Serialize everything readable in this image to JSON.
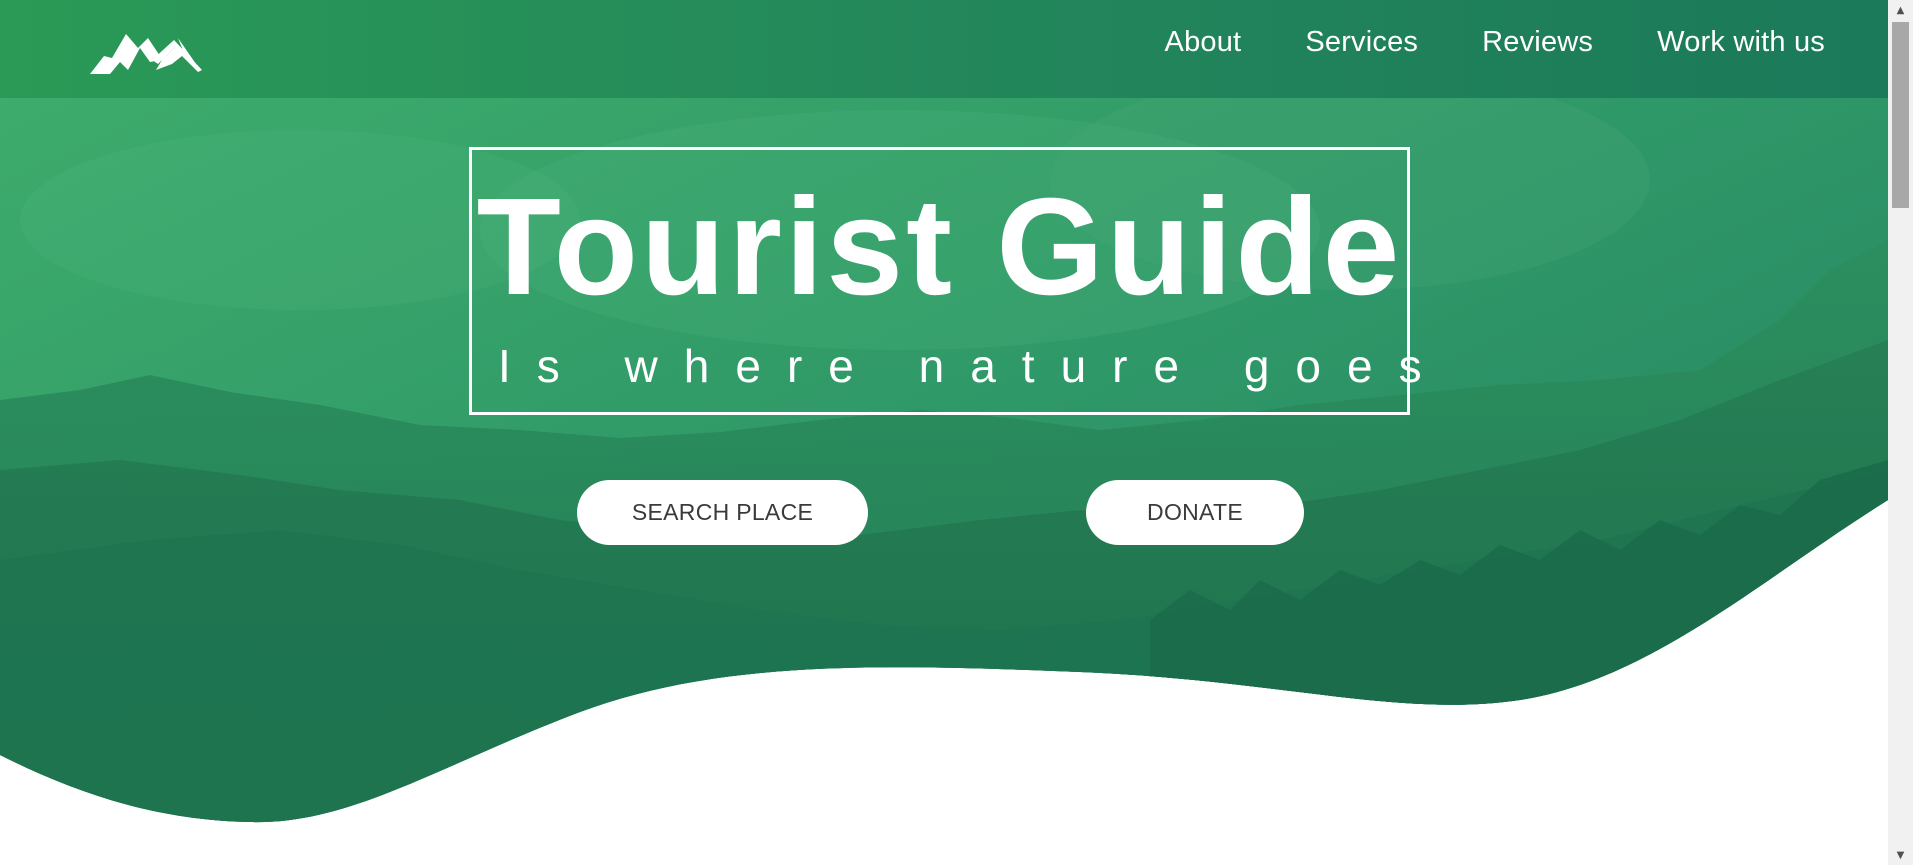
{
  "nav": {
    "items": [
      {
        "label": "About"
      },
      {
        "label": "Services"
      },
      {
        "label": "Reviews"
      },
      {
        "label": "Work with us"
      }
    ]
  },
  "hero": {
    "title": "Tourist Guide",
    "subtitle": "Is where nature goes",
    "buttons": {
      "search_label": "SEARCH PLACE",
      "donate_label": "DONATE"
    }
  },
  "logo": {
    "icon": "mountain-logo-icon"
  },
  "colors": {
    "brand_green": "#28a05a",
    "deep_green": "#1a7a58",
    "text_dark": "#3a3a3a",
    "white": "#ffffff"
  }
}
